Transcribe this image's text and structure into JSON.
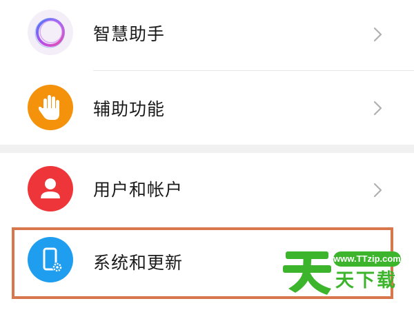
{
  "settings": {
    "items": [
      {
        "label": "智慧助手",
        "icon": "smart-assistant-ring-icon"
      },
      {
        "label": "辅助功能",
        "icon": "hand-icon",
        "color": "#f4930b"
      },
      {
        "label": "用户和帐户",
        "icon": "user-icon",
        "color": "#ee3539"
      },
      {
        "label": "系统和更新",
        "icon": "phone-settings-icon",
        "color": "#1f9ef0"
      }
    ]
  },
  "highlight": {
    "color": "#d9774c"
  },
  "watermark": {
    "site": "www.TTzip.com",
    "text": "天下载",
    "color": "#3cb52c"
  }
}
